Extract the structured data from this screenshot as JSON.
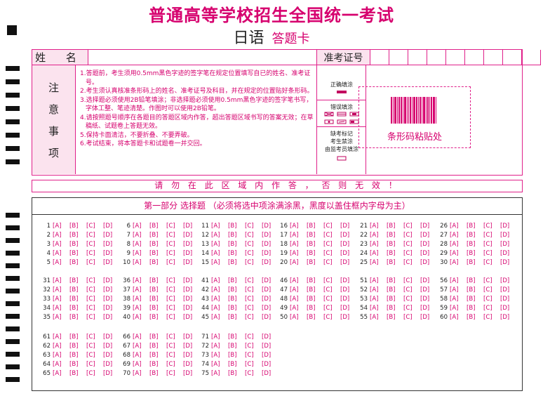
{
  "header": {
    "title": "普通高等学校招生全国统一考试",
    "subject": "日语",
    "card_label": "答题卡"
  },
  "info": {
    "name_label": "姓 名",
    "exam_id_label": "准考证号",
    "exam_id_boxes": 9
  },
  "notes": {
    "label": [
      "注",
      "意",
      "事",
      "项"
    ],
    "items": [
      "1.答题前，考生须用0.5mm黑色字迹的签字笔在规定位置填写自已的姓名、准考证号。",
      "2.考生须认真核准条形码上的姓名、准考证号及科目，并在规定的位置贴好条形码。",
      "3.选择题必须使用2B铅笔填涂；非选择题必须使用0.5mm黑色字迹的签字笔书写，字体工整、笔迹清楚。作图时可以使用2B铅笔。",
      "4.请按照题号顺序在各题目的答题区域内作答，超出答题区域书写的答案无效；在草稿纸、试题卷上答题无效。",
      "5.保持卡面清洁，不要折叠、不要弄破。",
      "6.考试结束，将本答题卡和试题卷一并交回。"
    ]
  },
  "fill": {
    "correct_label": "正确填涂",
    "wrong_label": "错误填涂",
    "absent_label": [
      "缺考标记",
      "考生禁涂",
      "由监考员填涂"
    ]
  },
  "barcode": {
    "label": "条形码粘贴处"
  },
  "warning": "请 勿 在 此 区 域 内 作 答 ， 否 则 无 效 ！",
  "section": {
    "title": "第一部分  选择题 （必须将选中项涂满涂黑，黑度以盖住框内字母为主）",
    "options": [
      "[A]",
      "[B]",
      "[C]",
      "[D]"
    ],
    "groups": [
      {
        "start": 1,
        "count": 5
      },
      {
        "start": 6,
        "count": 5
      },
      {
        "start": 11,
        "count": 5
      },
      {
        "start": 16,
        "count": 5
      },
      {
        "start": 21,
        "count": 5
      },
      {
        "start": 26,
        "count": 5
      },
      {
        "start": 31,
        "count": 5
      },
      {
        "start": 36,
        "count": 5
      },
      {
        "start": 41,
        "count": 5
      },
      {
        "start": 46,
        "count": 5
      },
      {
        "start": 51,
        "count": 5
      },
      {
        "start": 56,
        "count": 5
      },
      {
        "start": 61,
        "count": 5
      },
      {
        "start": 66,
        "count": 5
      },
      {
        "start": 71,
        "count": 5
      }
    ]
  }
}
